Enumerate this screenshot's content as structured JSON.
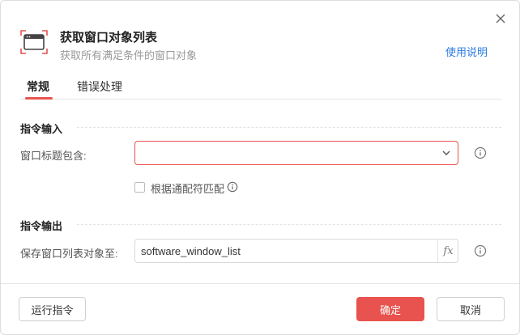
{
  "dialog": {
    "title": "获取窗口对象列表",
    "subtitle": "获取所有满足条件的窗口对象",
    "help_link": "使用说明"
  },
  "tabs": [
    {
      "label": "常规",
      "active": true
    },
    {
      "label": "错误处理",
      "active": false
    }
  ],
  "input_section": {
    "heading": "指令输入",
    "window_title_label": "窗口标题包含:",
    "window_title_value": "",
    "wildcard_label": "根据通配符匹配",
    "wildcard_checked": false
  },
  "output_section": {
    "heading": "指令输出",
    "save_label": "保存窗口列表对象至:",
    "save_value": "software_window_list",
    "fx_label": "fx"
  },
  "footer": {
    "run_label": "运行指令",
    "confirm_label": "确定",
    "cancel_label": "取消"
  },
  "colors": {
    "accent": "#e8534f",
    "link": "#2a7ae2"
  }
}
